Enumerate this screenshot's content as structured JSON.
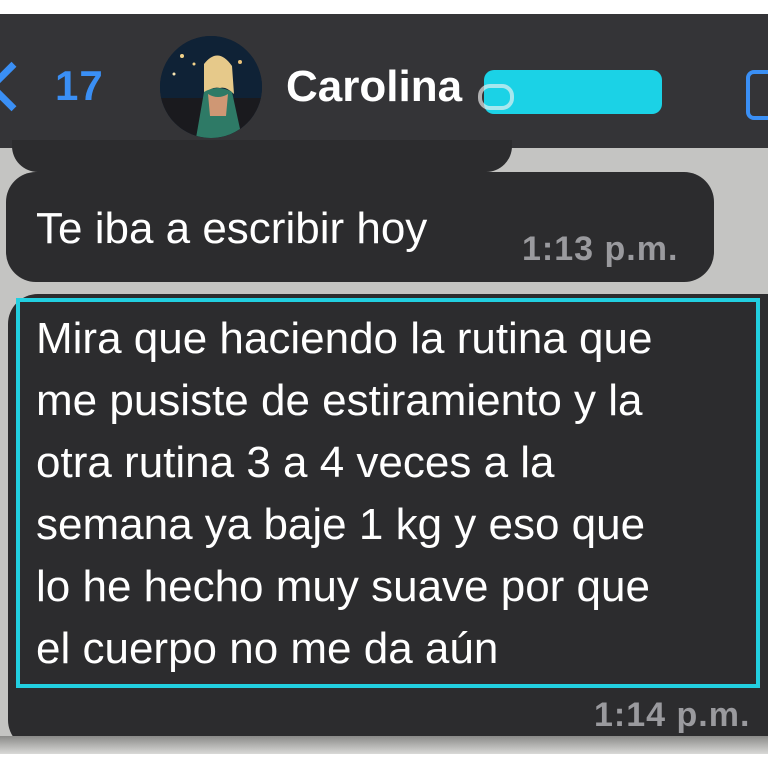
{
  "header": {
    "back_count": "17",
    "contact_name": "Carolina",
    "back_icon": "chevron-left-icon",
    "call_icon": "video-call-icon",
    "accent_color": "#3a8ff5",
    "redaction_color": "#1bd2e6"
  },
  "messages": [
    {
      "text": "Te iba a escribir hoy",
      "time": "1:13 p.m."
    },
    {
      "text": "Mira que haciendo la rutina que\nme pusiste de estiramiento y la\notra rutina 3 a 4 veces a la\nsemana ya baje 1 kg y eso que\nlo he hecho muy suave por que\nel cuerpo no me da aún",
      "time": "1:14 p.m."
    }
  ]
}
